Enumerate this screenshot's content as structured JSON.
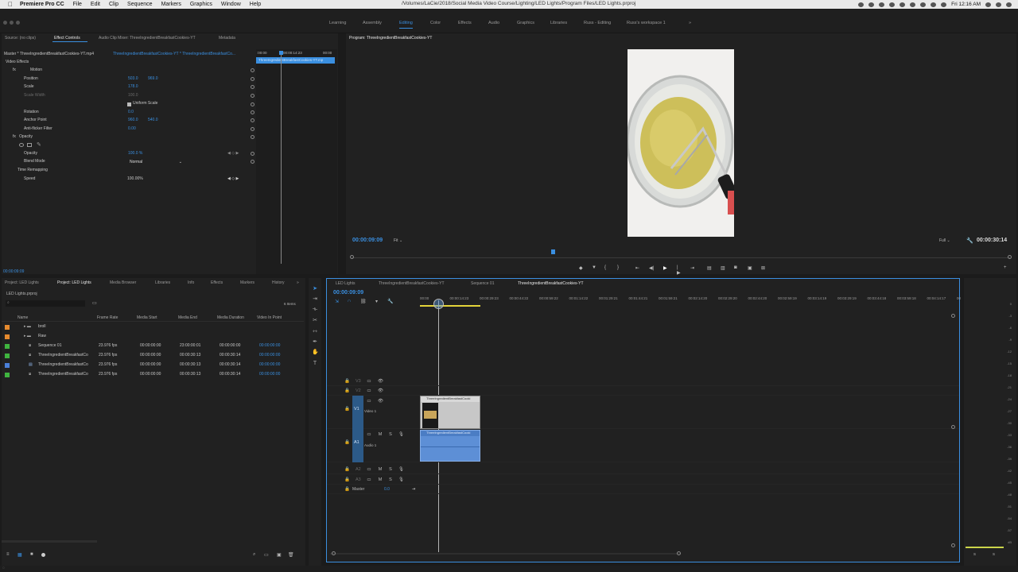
{
  "menubar": {
    "apple": "",
    "app": "Premiere Pro CC",
    "items": [
      "File",
      "Edit",
      "Clip",
      "Sequence",
      "Markers",
      "Graphics",
      "Window",
      "Help"
    ],
    "path": "/Volumes/LaCie/2018/Social Media Video Course/Lighting/LED Lights/Program Files/LED Lights.prproj",
    "clock": "Fri 12:16 AM"
  },
  "workspaces": [
    "Learning",
    "Assembly",
    "Editing",
    "Color",
    "Effects",
    "Audio",
    "Graphics",
    "Libraries",
    "Russ - Editing",
    "Russ's workspace 1"
  ],
  "workspace_more": "»",
  "effect_panel": {
    "tabs": [
      "Source: (no clips)",
      "Effect Controls",
      "Audio Clip Mixer: ThreeIngredientBreakfastCookies-YT",
      "Metadata"
    ],
    "master": "Master * ThreeIngredientBreakfastCookies-YT.mp4",
    "sequence": "ThreeIngredientBreakfastCookies-YT * ThreeIngredientBreakfastCo...",
    "mini_tc1": ":00:00",
    "mini_tc2": "00:00:14:23",
    "mini_tc3": "00:00",
    "mini_clip": "ThreeIngredientBreakfastCookies-YT.mp",
    "section": "Video Effects",
    "motion": "Motion",
    "position_label": "Position",
    "position_x": "503.0",
    "position_y": "969.0",
    "scale_label": "Scale",
    "scale_value": "178.0",
    "scale_width_label": "Scale Width",
    "scale_width_value": "100.0",
    "uniform_scale": "Uniform Scale",
    "rotation_label": "Rotation",
    "rotation_value": "0.0",
    "anchor_label": "Anchor Point",
    "anchor_x": "960.0",
    "anchor_y": "540.0",
    "flicker_label": "Anti-flicker Filter",
    "flicker_value": "0.00",
    "opacity_group": "Opacity",
    "opacity_label": "Opacity",
    "opacity_value": "100.0 %",
    "blend_label": "Blend Mode",
    "blend_value": "Normal",
    "time_remap": "Time Remapping",
    "speed_label": "Speed",
    "speed_value": "100.00%",
    "current_tc": "00:00:09:09"
  },
  "program": {
    "title": "Program: ThreeIngredientBreakfastCookies-YT",
    "timecode": "00:00:09:09",
    "fit": "Fit",
    "quality": "Full",
    "duration": "00:00:30:14",
    "playhead_fraction": 0.305
  },
  "project": {
    "tabs": [
      "Project: LED Lights",
      "Project: LED Lights",
      "Media Browser",
      "Libraries",
      "Info",
      "Effects",
      "Markers",
      "History"
    ],
    "more": "»",
    "file": "LED Lights.prproj",
    "item_count": "6 Items",
    "columns": [
      "Name",
      "Frame Rate",
      "Media Start",
      "Media End",
      "Media Duration",
      "Video In Point"
    ],
    "rows": [
      {
        "color": "#e58a2e",
        "name": "broll",
        "rate": "",
        "start": "",
        "end": "",
        "dur": "",
        "in": "",
        "type": "folder"
      },
      {
        "color": "#e58a2e",
        "name": "Raw",
        "rate": "",
        "start": "",
        "end": "",
        "dur": "",
        "in": "",
        "type": "folder"
      },
      {
        "color": "#3fb43f",
        "name": "Sequence 01",
        "rate": "23.976 fps",
        "start": "00:00:00:00",
        "end": "23:00:00:01",
        "dur": "00:00:00:00",
        "in": "00:00:00:00",
        "type": "sequence"
      },
      {
        "color": "#3fb43f",
        "name": "ThreeIngredientBreakfastCo",
        "rate": "23.976 fps",
        "start": "00:00:00:00",
        "end": "00:00:30:13",
        "dur": "00:00:30:14",
        "in": "00:00:00:00",
        "type": "sequence"
      },
      {
        "color": "#4a7fd8",
        "name": "ThreeIngredientBreakfastCo",
        "rate": "23.976 fps",
        "start": "00:00:00:00",
        "end": "00:00:30:13",
        "dur": "00:00:30:14",
        "in": "00:00:00:00",
        "type": "clip"
      },
      {
        "color": "#3fb43f",
        "name": "ThreeIngredientBreakfastCo",
        "rate": "23.976 fps",
        "start": "00:00:00:00",
        "end": "00:00:30:13",
        "dur": "00:00:30:14",
        "in": "00:00:00:00",
        "type": "sequence"
      }
    ]
  },
  "timeline": {
    "tabs": [
      "LED Lights",
      "ThreeIngredientBreakfastCookies-YT",
      "Sequence 01",
      "ThreeIngredientBreakfastCookies-YT"
    ],
    "timecode": "00:00:09:09",
    "ruler": [
      "00:00",
      "00:00:14:23",
      "00:00:29:23",
      "00:00:44:22",
      "00:00:59:22",
      "00:01:14:22",
      "00:01:29:21",
      "00:01:44:21",
      "00:01:59:21",
      "00:02:14:20",
      "00:02:29:20",
      "00:02:44:20",
      "00:02:59:19",
      "00:03:14:19",
      "00:03:29:19",
      "00:03:44:18",
      "00:03:59:18",
      "00:04:14:17",
      "00"
    ],
    "tracks": {
      "v3": "V3",
      "v2": "V2",
      "v1": "V1",
      "video1": "Video 1",
      "a1": "A1",
      "audio1": "Audio 1",
      "a2": "A2",
      "a3": "A3",
      "master": "Master",
      "master_value": "0.0"
    },
    "video_clip": "ThreeIngredientBreakfastCooki",
    "audio_clip": "ThreeIngredientBreakfastCooki",
    "track_buttons": {
      "m": "M",
      "s": "S"
    }
  },
  "meters": {
    "scale": [
      "0",
      "-3",
      "-6",
      "-9",
      "-12",
      "-15",
      "-18",
      "-21",
      "-24",
      "-27",
      "-30",
      "-33",
      "-36",
      "-39",
      "-42",
      "-45",
      "-48",
      "-51",
      "-54",
      "-57",
      "dB"
    ],
    "solo": [
      "S",
      "S"
    ]
  }
}
